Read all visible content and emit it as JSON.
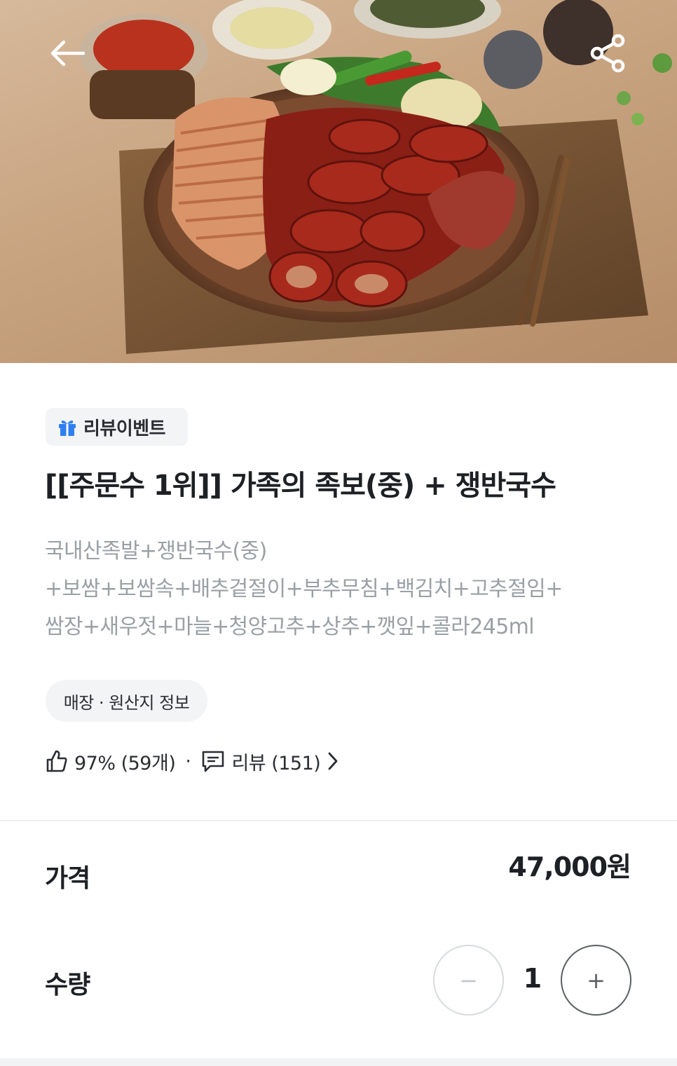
{
  "badge": {
    "label": "리뷰이벤트",
    "icon": "gift-icon"
  },
  "product": {
    "title": "[[주문수 1위]] 가족의 족보(중) + 쟁반국수",
    "description_lines": [
      "국내산족발+쟁반국수(중)",
      "+보쌈+보쌈속+배추겉절이+부추무침+백김치+고추절임+",
      "쌈장+새우젓+마늘+청양고추+상추+깻잎+콜라245ml"
    ]
  },
  "store_chip": {
    "label": "매장 · 원산지 정보"
  },
  "stats": {
    "like_icon": "thumbs-up-icon",
    "like_text": "97% (59개)",
    "separator": "·",
    "review_icon": "chat-bubble-icon",
    "review_text": "리뷰 (151)"
  },
  "price": {
    "label": "가격",
    "value": "47,000원"
  },
  "quantity": {
    "label": "수량",
    "value": "1",
    "minus": "−",
    "plus": "+"
  },
  "colors": {
    "text_primary": "#1d2024",
    "text_muted": "#9aa0a6",
    "chip_bg": "#f3f4f6",
    "gift_icon": "#2f7ff0"
  }
}
